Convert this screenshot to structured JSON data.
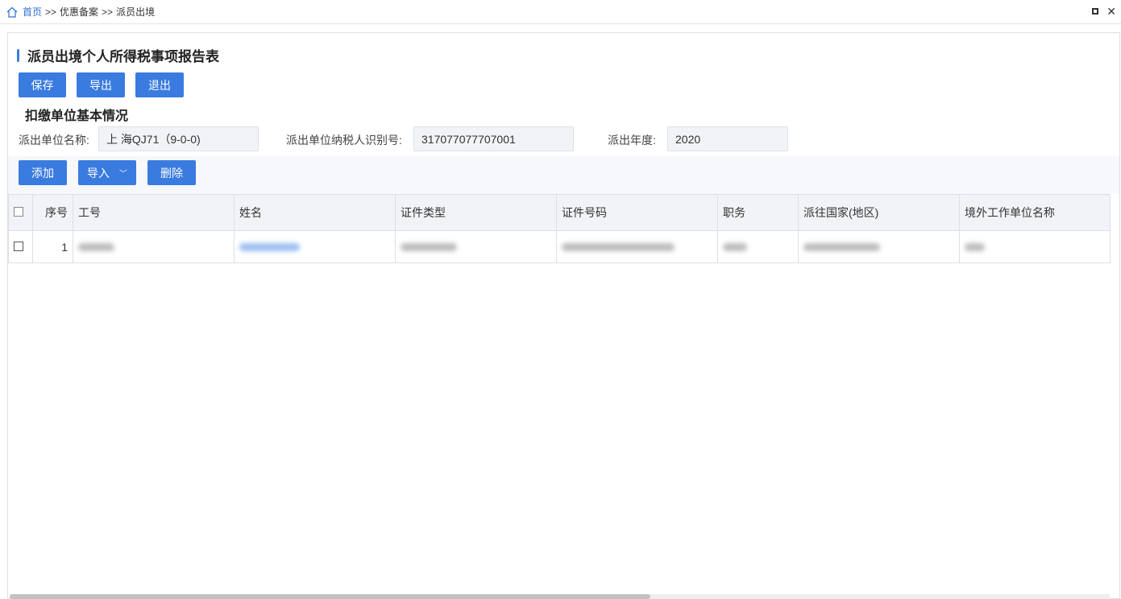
{
  "breadcrumb": {
    "home": "首页",
    "sep1": ">>",
    "item2": "优惠备案",
    "sep2": ">>",
    "current": "派员出境"
  },
  "page_title": "派员出境个人所得税事项报告表",
  "toolbar": {
    "save_label": "保存",
    "export_label": "导出",
    "exit_label": "退出"
  },
  "section_title": "扣缴单位基本情况",
  "fields": {
    "unit_name_label": "派出单位名称:",
    "unit_name_value": "上 海QJ71（9-0-0)",
    "taxpayer_id_label": "派出单位纳税人识别号:",
    "taxpayer_id_value": "317077077707001",
    "year_label": "派出年度:",
    "year_value": "2020"
  },
  "grid_toolbar": {
    "add_label": "添加",
    "import_label": "导入",
    "delete_label": "删除"
  },
  "table": {
    "columns": [
      "序号",
      "工号",
      "姓名",
      "证件类型",
      "证件号码",
      "职务",
      "派往国家(地区)",
      "境外工作单位名称"
    ],
    "rows": [
      {
        "index": "1"
      }
    ]
  },
  "colors": {
    "primary": "#3a7bdf",
    "link": "#2f6fd1",
    "header_bg": "#f1f3f6"
  }
}
